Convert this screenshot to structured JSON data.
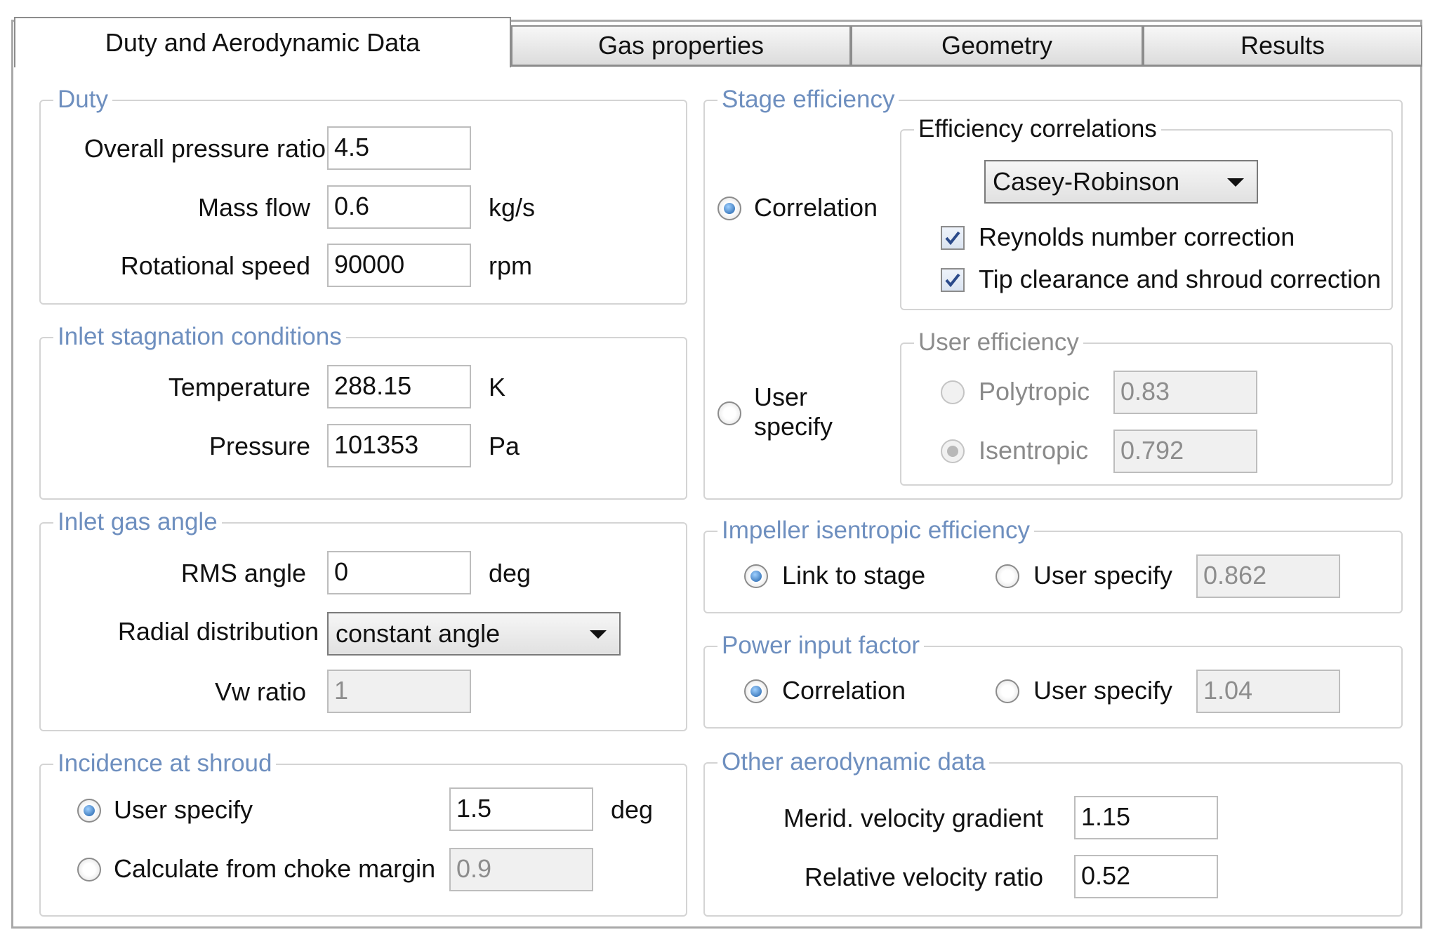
{
  "tabs": [
    {
      "label": "Duty and Aerodynamic Data",
      "active": true
    },
    {
      "label": "Gas properties",
      "active": false
    },
    {
      "label": "Geometry",
      "active": false
    },
    {
      "label": "Results",
      "active": false
    }
  ],
  "duty": {
    "title": "Duty",
    "pressure_ratio": {
      "label": "Overall pressure ratio",
      "value": "4.5"
    },
    "mass_flow": {
      "label": "Mass flow",
      "value": "0.6",
      "unit": "kg/s"
    },
    "speed": {
      "label": "Rotational speed",
      "value": "90000",
      "unit": "rpm"
    }
  },
  "inlet_stagnation": {
    "title": "Inlet stagnation conditions",
    "temperature": {
      "label": "Temperature",
      "value": "288.15",
      "unit": "K"
    },
    "pressure": {
      "label": "Pressure",
      "value": "101353",
      "unit": "Pa"
    }
  },
  "inlet_gas_angle": {
    "title": "Inlet gas angle",
    "rms_angle": {
      "label": "RMS angle",
      "value": "0",
      "unit": "deg"
    },
    "radial_distribution": {
      "label": "Radial distribution",
      "value": "constant angle"
    },
    "vw_ratio": {
      "label": "Vw ratio",
      "value": "1"
    }
  },
  "incidence": {
    "title": "Incidence at shroud",
    "user_specify": {
      "label": "User specify",
      "value": "1.5",
      "unit": "deg",
      "selected": true
    },
    "choke_margin": {
      "label": "Calculate from choke margin",
      "value": "0.9",
      "selected": false
    }
  },
  "stage_efficiency": {
    "title": "Stage efficiency",
    "correlation_label": "Correlation",
    "user_specify_label_1": "User",
    "user_specify_label_2": "specify",
    "correlations": {
      "title": "Efficiency correlations",
      "method": "Casey-Robinson",
      "reynolds": {
        "label": "Reynolds number correction",
        "checked": true
      },
      "tip_clearance": {
        "label": "Tip clearance and shroud correction",
        "checked": true
      }
    },
    "user_efficiency": {
      "title": "User efficiency",
      "polytropic": {
        "label": "Polytropic",
        "value": "0.83"
      },
      "isentropic": {
        "label": "Isentropic",
        "value": "0.792"
      }
    }
  },
  "impeller_efficiency": {
    "title": "Impeller isentropic efficiency",
    "link_label": "Link to stage",
    "user_label": "User specify",
    "value": "0.862"
  },
  "power_input": {
    "title": "Power input factor",
    "correlation_label": "Correlation",
    "user_label": "User specify",
    "value": "1.04"
  },
  "other_aero": {
    "title": "Other aerodynamic data",
    "merid": {
      "label": "Merid. velocity gradient",
      "value": "1.15"
    },
    "rel_vel": {
      "label": "Relative velocity ratio",
      "value": "0.52"
    }
  }
}
